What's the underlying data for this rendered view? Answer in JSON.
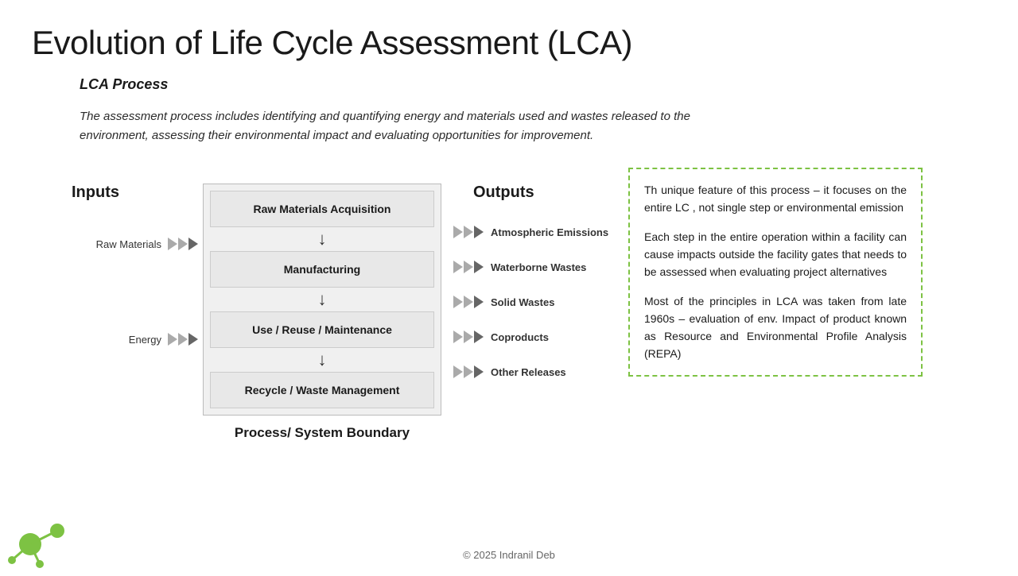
{
  "title": "Evolution of Life Cycle Assessment (LCA)",
  "section_label": "LCA Process",
  "description": "The assessment process includes identifying and quantifying energy and materials used and wastes released to the environment, assessing their environmental impact and evaluating opportunities for improvement.",
  "inputs": {
    "heading": "Inputs",
    "items": [
      {
        "label": "Raw Materials"
      },
      {
        "label": "Energy"
      }
    ]
  },
  "process": {
    "steps": [
      {
        "label": "Raw Materials Acquisition"
      },
      {
        "label": "Manufacturing"
      },
      {
        "label": "Use / Reuse / Maintenance"
      },
      {
        "label": "Recycle / Waste Management"
      }
    ],
    "boundary_label": "Process/ System Boundary"
  },
  "outputs": {
    "heading": "Outputs",
    "items": [
      {
        "label": "Atmospheric Emissions"
      },
      {
        "label": "Waterborne Wastes"
      },
      {
        "label": "Solid Wastes"
      },
      {
        "label": "Coproducts"
      },
      {
        "label": "Other Releases"
      }
    ]
  },
  "info_box": {
    "paragraphs": [
      "Th unique feature of this process – it focuses on the entire LC , not single step or environmental emission",
      "Each step in the entire operation within a facility can cause impacts outside the facility gates that needs to be assessed when evaluating project alternatives",
      "Most of the principles in LCA was taken from late 1960s – evaluation of env. Impact of product known as Resource and Environmental Profile Analysis (REPA)"
    ]
  },
  "footer": "© 2025 Indranil Deb"
}
